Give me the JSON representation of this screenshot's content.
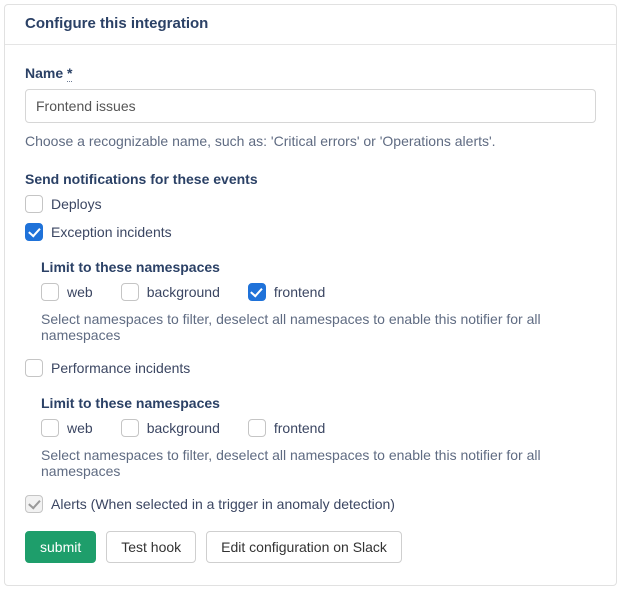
{
  "header": {
    "title": "Configure this integration"
  },
  "name_field": {
    "label": "Name",
    "required_mark": "*",
    "value": "Frontend issues",
    "helper": "Choose a recognizable name, such as: 'Critical errors' or 'Operations alerts'."
  },
  "events": {
    "title": "Send notifications for these events",
    "deploys": {
      "label": "Deploys",
      "checked": false
    },
    "exception": {
      "label": "Exception incidents",
      "checked": true,
      "limit_title": "Limit to these namespaces",
      "namespaces": [
        {
          "label": "web",
          "checked": false
        },
        {
          "label": "background",
          "checked": false
        },
        {
          "label": "frontend",
          "checked": true
        }
      ],
      "ns_help": "Select namespaces to filter, deselect all namespaces to enable this notifier for all namespaces"
    },
    "performance": {
      "label": "Performance incidents",
      "checked": false,
      "limit_title": "Limit to these namespaces",
      "namespaces": [
        {
          "label": "web",
          "checked": false
        },
        {
          "label": "background",
          "checked": false
        },
        {
          "label": "frontend",
          "checked": false
        }
      ],
      "ns_help": "Select namespaces to filter, deselect all namespaces to enable this notifier for all namespaces"
    },
    "alerts": {
      "label": "Alerts (When selected in a trigger in anomaly detection)",
      "checked": true,
      "disabled": true
    }
  },
  "actions": {
    "submit": "submit",
    "test_hook": "Test hook",
    "edit_slack": "Edit configuration on Slack"
  }
}
